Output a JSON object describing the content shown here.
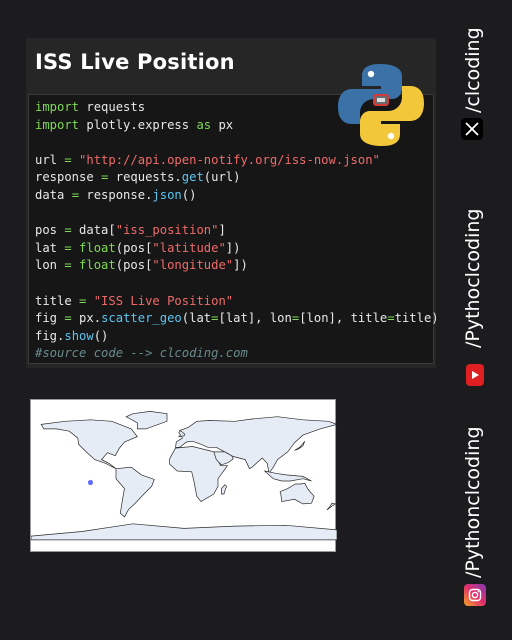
{
  "card": {
    "title": "ISS Live Position",
    "code_lines": [
      [
        [
          "kw",
          "import"
        ],
        [
          "t",
          " requests"
        ]
      ],
      [
        [
          "kw",
          "import"
        ],
        [
          "t",
          " plotly.express "
        ],
        [
          "kw",
          "as"
        ],
        [
          "t",
          " px"
        ]
      ],
      [],
      [
        [
          "t",
          "url "
        ],
        [
          "kw",
          "="
        ],
        [
          "t",
          " "
        ],
        [
          "str",
          "\"http://api.open-notify.org/iss-now.json\""
        ]
      ],
      [
        [
          "t",
          "response "
        ],
        [
          "kw",
          "="
        ],
        [
          "t",
          " requests."
        ],
        [
          "fn",
          "get"
        ],
        [
          "t",
          "(url)"
        ]
      ],
      [
        [
          "t",
          "data "
        ],
        [
          "kw",
          "="
        ],
        [
          "t",
          " response."
        ],
        [
          "fn",
          "json"
        ],
        [
          "t",
          "()"
        ]
      ],
      [],
      [
        [
          "t",
          "pos "
        ],
        [
          "kw",
          "="
        ],
        [
          "t",
          " data["
        ],
        [
          "str",
          "\"iss_position\""
        ],
        [
          "t",
          "]"
        ]
      ],
      [
        [
          "t",
          "lat "
        ],
        [
          "kw",
          "="
        ],
        [
          "t",
          " "
        ],
        [
          "kw",
          "float"
        ],
        [
          "t",
          "(pos["
        ],
        [
          "str",
          "\"latitude\""
        ],
        [
          "t",
          "])"
        ]
      ],
      [
        [
          "t",
          "lon "
        ],
        [
          "kw",
          "="
        ],
        [
          "t",
          " "
        ],
        [
          "kw",
          "float"
        ],
        [
          "t",
          "(pos["
        ],
        [
          "str",
          "\"longitude\""
        ],
        [
          "t",
          "])"
        ]
      ],
      [],
      [
        [
          "t",
          "title "
        ],
        [
          "kw",
          "="
        ],
        [
          "t",
          " "
        ],
        [
          "str",
          "\"ISS Live Position\""
        ]
      ],
      [
        [
          "t",
          "fig "
        ],
        [
          "kw",
          "="
        ],
        [
          "t",
          " px."
        ],
        [
          "fn",
          "scatter_geo"
        ],
        [
          "t",
          "(lat"
        ],
        [
          "kw",
          "="
        ],
        [
          "t",
          "[lat], lon"
        ],
        [
          "kw",
          "="
        ],
        [
          "t",
          "[lon], title"
        ],
        [
          "kw",
          "="
        ],
        [
          "t",
          "title)"
        ]
      ],
      [
        [
          "t",
          "fig."
        ],
        [
          "fn",
          "show"
        ],
        [
          "t",
          "()"
        ]
      ],
      [
        [
          "cm",
          "#source code --> clcoding.com"
        ]
      ]
    ]
  },
  "map": {
    "land_color": "#e5ecf6",
    "coast_color": "#2a2a2a",
    "marker_color": "#636efa",
    "marker": {
      "lat": -10,
      "lon": -110
    }
  },
  "side": {
    "x_handle": "/clcoding",
    "youtube_handle": "/Pythoclcoding",
    "instagram_handle": "/Pythonclcoding"
  },
  "colors": {
    "background": "#1c1c1e",
    "keyword": "#7ed957",
    "string": "#f06a6a",
    "function": "#5cc6f0",
    "comment": "#6a8a8c"
  }
}
